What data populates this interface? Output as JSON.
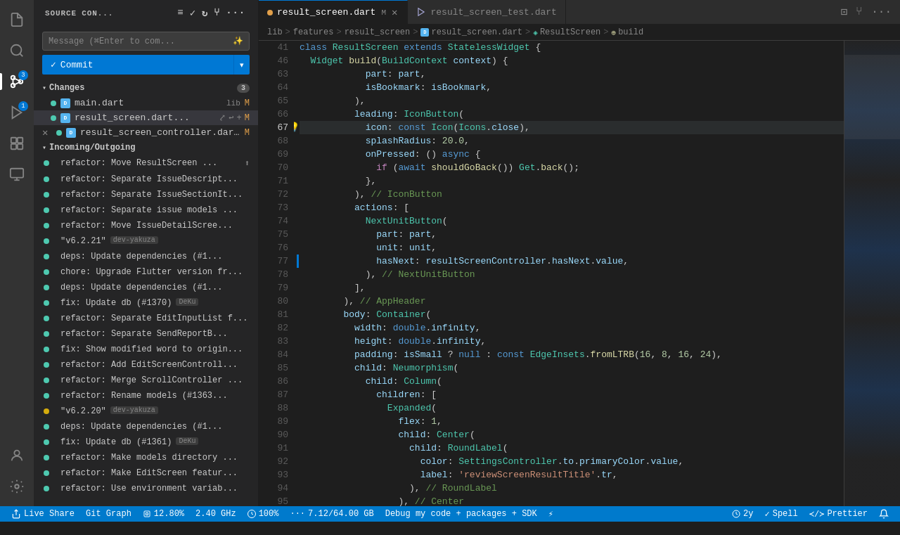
{
  "activityBar": {
    "icons": [
      {
        "name": "explorer-icon",
        "symbol": "⬜",
        "active": false
      },
      {
        "name": "search-icon",
        "symbol": "🔍",
        "active": false
      },
      {
        "name": "source-control-icon",
        "symbol": "⑂",
        "active": true,
        "badge": "3"
      },
      {
        "name": "run-icon",
        "symbol": "▷",
        "active": false,
        "badge": "1"
      },
      {
        "name": "extensions-icon",
        "symbol": "⊞",
        "active": false
      },
      {
        "name": "remote-icon",
        "symbol": "⊕",
        "active": false
      }
    ],
    "bottomIcons": [
      {
        "name": "account-icon",
        "symbol": "👤"
      },
      {
        "name": "settings-icon",
        "symbol": "⚙"
      }
    ]
  },
  "sidebar": {
    "title": "SOURCE CON...",
    "messageInput": {
      "placeholder": "Message (⌘Enter to com...",
      "aiIcon": "✨"
    },
    "commitButton": {
      "label": "Commit",
      "checkmark": "✓"
    },
    "changes": {
      "label": "Changes",
      "count": "3",
      "files": [
        {
          "name": "main.dart",
          "tag": "lib",
          "marker": "M",
          "dotColor": "blue"
        },
        {
          "name": "result_screen.dart...",
          "marker": "M",
          "dotColor": "blue",
          "hasActions": true
        },
        {
          "name": "result_screen_controller.dar...",
          "marker": "M",
          "dotColor": "blue",
          "hasClose": true
        }
      ]
    },
    "incomingOutgoing": {
      "label": "Incoming/Outgoing",
      "commits": [
        {
          "text": "refactor: Move ResultScreen ...",
          "dotColor": "blue",
          "hasPush": true
        },
        {
          "text": "refactor: Separate IssueDescript...",
          "dotColor": "blue"
        },
        {
          "text": "refactor: Separate IssueSectionIt...",
          "dotColor": "blue"
        },
        {
          "text": "refactor: Separate issue models ...",
          "dotColor": "blue"
        },
        {
          "text": "refactor: Move IssueDetailScree...",
          "dotColor": "blue"
        },
        {
          "text": "\"v6.2.21\"",
          "tag": "dev-yakuza",
          "dotColor": "blue"
        },
        {
          "text": "deps: Update dependencies (#1...",
          "dotColor": "blue"
        },
        {
          "text": "chore: Upgrade Flutter version fr...",
          "dotColor": "blue"
        },
        {
          "text": "deps: Update dependencies (#1...",
          "dotColor": "blue"
        },
        {
          "text": "fix: Update db (#1370)",
          "tag": "DeKu",
          "dotColor": "blue"
        },
        {
          "text": "refactor: Separate EditInputList f...",
          "dotColor": "blue"
        },
        {
          "text": "refactor: Separate SendReportB...",
          "dotColor": "blue"
        },
        {
          "text": "fix: Show modified word to origin...",
          "dotColor": "blue"
        },
        {
          "text": "refactor: Add EditScreenControll...",
          "dotColor": "blue"
        },
        {
          "text": "refactor: Merge ScrollController ...",
          "dotColor": "blue"
        },
        {
          "text": "refactor: Rename models (#1363...",
          "dotColor": "blue"
        },
        {
          "text": "\"v6.2.20\"",
          "tag": "dev-yakuza",
          "dotColor": "orange"
        },
        {
          "text": "deps: Update dependencies (#1...",
          "dotColor": "blue"
        },
        {
          "text": "fix: Update db (#1361)",
          "tag": "DeKu",
          "dotColor": "blue"
        },
        {
          "text": "refactor: Make models directory ...",
          "dotColor": "blue"
        },
        {
          "text": "refactor: Make EditScreen featur...",
          "dotColor": "blue"
        },
        {
          "text": "refactor: Use environment variab...",
          "dotColor": "blue"
        }
      ]
    }
  },
  "tabs": [
    {
      "label": "result_screen.dart",
      "modified": true,
      "active": true,
      "dotColor": "orange"
    },
    {
      "label": "result_screen_test.dart",
      "modified": false,
      "active": false
    }
  ],
  "breadcrumb": {
    "items": [
      "lib",
      "features",
      "result_screen",
      "result_screen.dart",
      "ResultScreen",
      "build"
    ]
  },
  "editor": {
    "lines": [
      {
        "num": 41,
        "code": "class ResultScreen extends StatelessWidget {"
      },
      {
        "num": 46,
        "code": "  Widget build(BuildContext context) {"
      },
      {
        "num": 63,
        "code": "            part: part,"
      },
      {
        "num": 64,
        "code": "            isBookmark: isBookmark,"
      },
      {
        "num": 65,
        "code": "          ),"
      },
      {
        "num": 66,
        "code": "          leading: IconButton("
      },
      {
        "num": 67,
        "code": "            icon: const Icon(Icons.close),",
        "highlight": true,
        "lightbulb": true
      },
      {
        "num": 68,
        "code": "            splashRadius: 20.0,"
      },
      {
        "num": 69,
        "code": "            onPressed: () async {"
      },
      {
        "num": 70,
        "code": "              if (await shouldGoBack()) Get.back();"
      },
      {
        "num": 71,
        "code": "            },"
      },
      {
        "num": 72,
        "code": "          ), // IconButton"
      },
      {
        "num": 73,
        "code": "          actions: ["
      },
      {
        "num": 74,
        "code": "            NextUnitButton("
      },
      {
        "num": 75,
        "code": "              part: part,"
      },
      {
        "num": 76,
        "code": "              unit: unit,"
      },
      {
        "num": 77,
        "code": "              hasNext: resultScreenController.hasNext.value,"
      },
      {
        "num": 78,
        "code": "            ), // NextUnitButton"
      },
      {
        "num": 79,
        "code": "          ],"
      },
      {
        "num": 80,
        "code": "        ), // AppHeader"
      },
      {
        "num": 81,
        "code": "        body: Container("
      },
      {
        "num": 82,
        "code": "          width: double.infinity,"
      },
      {
        "num": 83,
        "code": "          height: double.infinity,"
      },
      {
        "num": 84,
        "code": "          padding: isSmall ? null : const EdgeInsets.fromLTRB(16, 8, 16, 24),"
      },
      {
        "num": 85,
        "code": "          child: Neumorphism("
      },
      {
        "num": 86,
        "code": "            child: Column("
      },
      {
        "num": 87,
        "code": "              children: ["
      },
      {
        "num": 88,
        "code": "                Expanded("
      },
      {
        "num": 89,
        "code": "                  flex: 1,"
      },
      {
        "num": 90,
        "code": "                  child: Center("
      },
      {
        "num": 91,
        "code": "                    child: RoundLabel("
      },
      {
        "num": 92,
        "code": "                      color: SettingsController.to.primaryColor.value,"
      },
      {
        "num": 93,
        "code": "                      label: 'reviewScreenResultTitle'.tr,"
      },
      {
        "num": 94,
        "code": "                    ), // RoundLabel"
      },
      {
        "num": 95,
        "code": "                  ), // Center"
      }
    ]
  },
  "statusBar": {
    "liveshare": "Live Share",
    "gitGraph": "Git Graph",
    "cpu": "12.80%",
    "freq": "2.40 GHz",
    "power": "100%",
    "memory": "7.12/64.00 GB",
    "debug": "Debug my code + packages + SDK",
    "lines": "2y",
    "spell": "Spell",
    "prettier": "Prettier"
  }
}
